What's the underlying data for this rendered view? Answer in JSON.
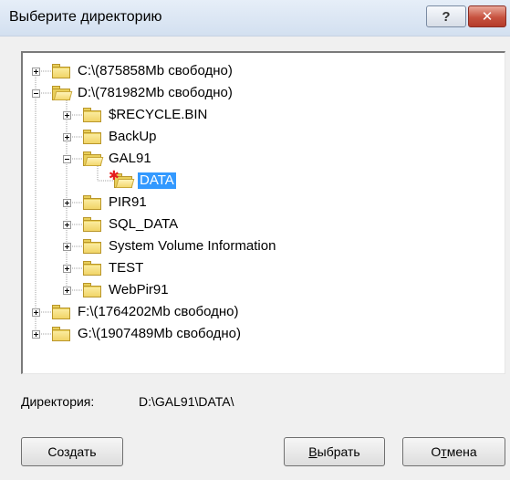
{
  "window": {
    "title": "Выберите директорию",
    "help_symbol": "?",
    "close_symbol": "✕"
  },
  "tree": {
    "nodes": [
      {
        "label": "C:\\(875858Mb свободно)",
        "expand": "+",
        "depth": 0
      },
      {
        "label": "D:\\(781982Mb свободно)",
        "expand": "-",
        "depth": 0
      },
      {
        "label": "$RECYCLE.BIN",
        "expand": "+",
        "depth": 1
      },
      {
        "label": "BackUp",
        "expand": "+",
        "depth": 1
      },
      {
        "label": "GAL91",
        "expand": "-",
        "depth": 1
      },
      {
        "label": "DATA",
        "expand": "",
        "depth": 2,
        "selected": true
      },
      {
        "label": "PIR91",
        "expand": "+",
        "depth": 1
      },
      {
        "label": "SQL_DATA",
        "expand": "+",
        "depth": 1
      },
      {
        "label": "System Volume Information",
        "expand": "+",
        "depth": 1
      },
      {
        "label": "TEST",
        "expand": "+",
        "depth": 1
      },
      {
        "label": "WebPir91",
        "expand": "+",
        "depth": 1
      },
      {
        "label": "F:\\(1764202Mb свободно)",
        "expand": "+",
        "depth": 0
      },
      {
        "label": "G:\\(1907489Mb свободно)",
        "expand": "+",
        "depth": 0
      }
    ]
  },
  "directory": {
    "label": "Директория:",
    "value": "D:\\GAL91\\DATA\\"
  },
  "buttons": {
    "create": "Создать",
    "select_first": "В",
    "select_rest": "ыбрать",
    "cancel_first": "О",
    "cancel_u": "т",
    "cancel_rest": "мена"
  },
  "colors": {
    "selection": "#3399ff",
    "folder": "#f1d467",
    "close": "#c7523f"
  }
}
